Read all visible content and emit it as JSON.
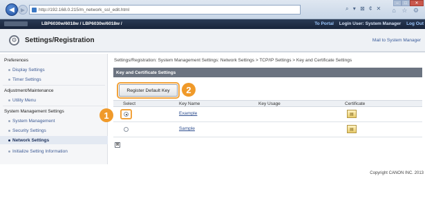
{
  "browser": {
    "address": "http://192.168.0.215/m_network_ssl_edit.html",
    "toolbar_glyphs": "⌕ ▾ ⊠ ¢ ✕",
    "right_glyphs": "⌂ ☆ ⚙"
  },
  "device": {
    "name": "LBP6030w/6018w / LBP6030w/6018w /",
    "to_portal": "To Portal",
    "login_user": "Login User: System Manager",
    "logout": "Log Out"
  },
  "settings": {
    "title": "Settings/Registration",
    "mail_link": "Mail to System Manager"
  },
  "sidebar": {
    "preferences": "Preferences",
    "display_settings": "Display Settings",
    "timer_settings": "Timer Settings",
    "adjustment": "Adjustment/Maintenance",
    "utility_menu": "Utility Menu",
    "system_management_settings": "System Management Settings",
    "system_management": "System Management",
    "security_settings": "Security Settings",
    "network_settings": "Network Settings",
    "initialize": "Initialize Setting Information"
  },
  "main": {
    "breadcrumb": "Settings/Registration: System Management Settings: Network Settings > TCP/IP Settings > Key and Certificate Settings",
    "section_title": "Key and Certificate Settings",
    "register_button": "Register Default Key",
    "columns": {
      "select": "Select",
      "key_name": "Key Name",
      "key_usage": "Key Usage",
      "certificate": "Certificate"
    },
    "rows": [
      {
        "key_name": "Example",
        "key_usage": "",
        "selected": true
      },
      {
        "key_name": "Sample",
        "key_usage": "",
        "selected": false
      }
    ],
    "expand_glyph": "⊠",
    "certificate_glyph": "▤"
  },
  "callouts": {
    "one": "1",
    "two": "2"
  },
  "footer": {
    "copyright": "Copyright CANON INC. 2013"
  },
  "colors": {
    "callout": "#f09a2a",
    "section_bar": "#6b7380",
    "device_bar": "#18243a"
  }
}
